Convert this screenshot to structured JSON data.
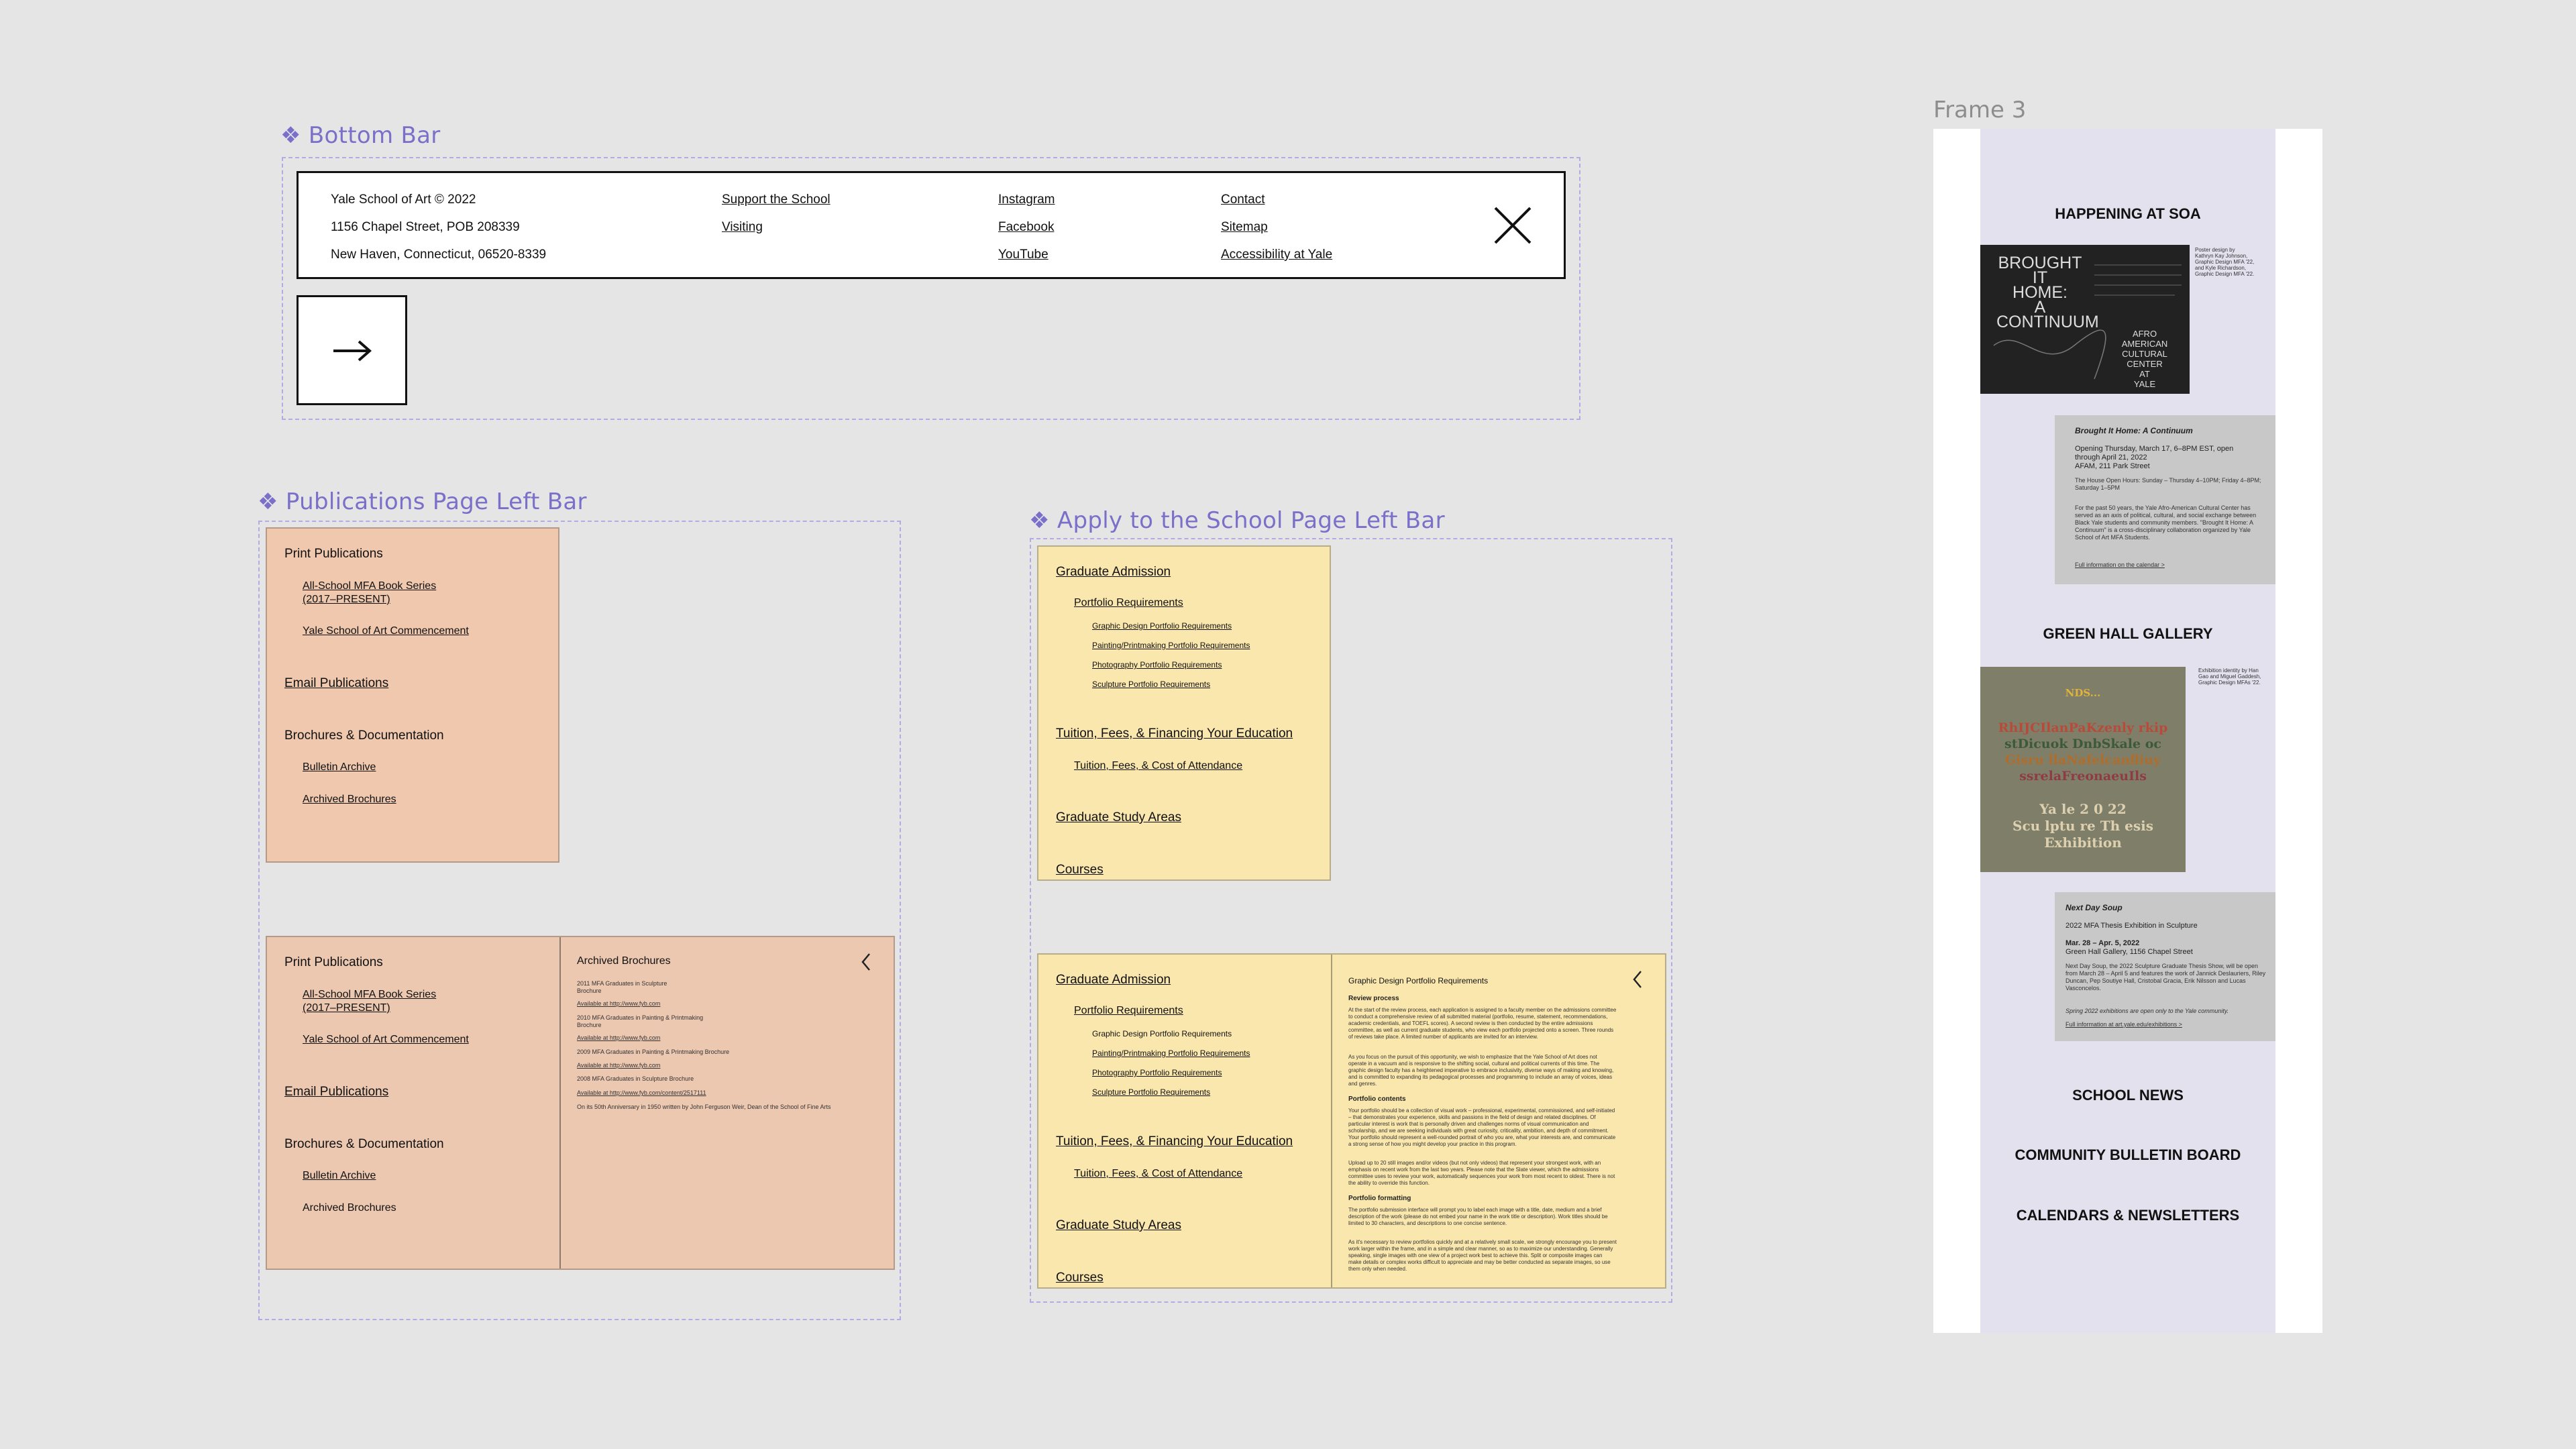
{
  "frame3": {
    "label": "Frame 3",
    "sections": {
      "happening": "HAPPENING AT SOA",
      "gallery": "GREEN HALL GALLERY",
      "news": "SCHOOL NEWS",
      "bulletin": "COMMUNITY BULLETIN BOARD",
      "calendars": "CALENDARS & NEWSLETTERS"
    },
    "poster1": {
      "title_lines": [
        "BROUGHT",
        "IT",
        "HOME:",
        "A",
        "CONTINUUM"
      ],
      "right_lines": [
        "AFRO",
        "AMERICAN",
        "CULTURAL",
        "CENTER",
        "AT",
        "YALE"
      ],
      "credit": [
        "Poster design by",
        "Kathryn Kay Johnson,",
        "Graphic Design MFA '22,",
        "and Kyle Richardson,",
        "Graphic Design MFA '22."
      ]
    },
    "card1": {
      "title": "Brought It Home: A Continuum",
      "lines": [
        "Opening Thursday, March 17, 6–8PM EST, open",
        "through April 21, 2022",
        "AFAM, 211 Park Street"
      ],
      "hours": "The House Open Hours: Sunday – Thursday 4–10PM; Friday 4–8PM; Saturday 1–5PM",
      "body": "For the past 50 years, the Yale Afro-American Cultural Center has served as an axis of political, cultural, and social exchange between Black Yale students and community members. \"Brought It Home: A Continuum\" is a cross-disciplinary collaboration organized by Yale School of Art MFA Students.",
      "link": "Full information on the calendar >"
    },
    "poster2": {
      "lines": [
        "NDS...",
        "RhIJCIlanPaKzenly rkip",
        "stDicuok DnbSkale oc",
        "Gisru llaNafelcanfliuy",
        "ssrelaFreonaeuIls",
        "Ya le 2 0 22",
        "Scu lptu re Th esis",
        "Exhibition"
      ],
      "credit": [
        "Exhibition identity by Han",
        "Gao and Miguel Gaddesh,",
        "Graphic Design MFAs '22."
      ]
    },
    "card2": {
      "title": "Next Day Soup",
      "subtitle": "2022 MFA Thesis Exhibition in Sculpture",
      "date": "Mar. 28 – Apr. 5, 2022",
      "place": "Green Hall Gallery, 1156 Chapel Street",
      "body": "Next Day Soup, the 2022 Sculpture Graduate Thesis Show, will be open from March 28 – April 5 and features the work of Jannick Deslauriers, Riley Duncan, Pep Soutiye Hall, Cristobal Gracia, Erik Nilsson and Lucas Vasconcelos.",
      "note": "Spring 2022 exhibitions are open only to the Yale community.",
      "link": "Full information at art.yale.edu/exhibitions >"
    }
  },
  "bottom_bar": {
    "label": "❖ Bottom Bar",
    "address": [
      "Yale School of Art © 2022",
      "1156 Chapel Street, POB 208339",
      "New Haven, Connecticut, 06520-8339"
    ],
    "col2": [
      "Support the School",
      "Visiting"
    ],
    "col3": [
      "Instagram",
      "Facebook",
      "YouTube"
    ],
    "col4": [
      "Contact",
      "Sitemap",
      "Accessibility at Yale"
    ],
    "close_icon": "×",
    "arrow_icon": "→"
  },
  "publications": {
    "label": "❖ Publications Page Left Bar",
    "menu": {
      "print": "Print Publications",
      "mfa_book": "All-School MFA Book Series",
      "mfa_book_2": "(2017–PRESENT)",
      "commencement": "Yale School of Art Commencement",
      "email": "Email Publications",
      "brochures": "Brochures & Documentation",
      "bulletin": "Bulletin Archive",
      "archived": "Archived Brochures"
    },
    "panel": {
      "title": "Archived Brochures",
      "lines": [
        "2011 MFA Graduates in Sculpture",
        "Brochure",
        "Available at http://www.fyb.com",
        "2010 MFA Graduates in Painting & Printmaking",
        "Brochure",
        "Available at http://www.fyb.com",
        "2009 MFA Graduates in Painting & Printmaking Brochure",
        "Available at http://www.fyb.com",
        "2008 MFA Graduates in Sculpture Brochure",
        "Available at http://www.fyb.com/content/2517111",
        "On its 50th Anniversary in 1950 written by John Ferguson Weir, Dean of the School of Fine Arts"
      ],
      "back_icon": "‹"
    }
  },
  "apply": {
    "label": "❖ Apply to the School Page Left Bar",
    "menu": {
      "admission": "Graduate Admission",
      "portfolio": "Portfolio Requirements",
      "gd": "Graphic Design Portfolio Requirements",
      "pp": "Painting/Printmaking Portfolio Requirements",
      "photo": "Photography Portfolio Requirements",
      "sculpt": "Sculpture Portfolio Requirements",
      "tuition": "Tuition, Fees, & Financing Your Education",
      "tuition_sub": "Tuition, Fees, & Cost of Attendance",
      "study": "Graduate Study Areas",
      "courses": "Courses"
    },
    "panel": {
      "title": "Graphic Design Portfolio Requirements",
      "h_review": "Review process",
      "p_review": "At the start of the review process, each application is assigned to a faculty member on the admissions committee to conduct a comprehensive review of all submitted material (portfolio, resume, statement, recommendations, academic credentials, and TOEFL scores). A second review is then conducted by the entire admissions committee, as well as current graduate students, who view each portfolio projected onto a screen. Three rounds of reviews take place. A limited number of applicants are invited for an interview.",
      "p_review2": "As you focus on the pursuit of this opportunity, we wish to emphasize that the Yale School of Art does not operate in a vacuum and is responsive to the shifting social, cultural and political currents of this time. The graphic design faculty has a heightened imperative to embrace inclusivity, diverse ways of making and knowing, and is committed to expanding its pedagogical processes and programming to include an array of voices, ideas and genres.",
      "h_contents": "Portfolio contents",
      "p_contents": "Your portfolio should be a collection of visual work – professional, experimental, commissioned, and self-initiated – that demonstrates your experience, skills and passions in the field of design and related disciplines. Of particular interest is work that is personally driven and challenges norms of visual communication and scholarship, and we are seeking individuals with great curiosity, criticality, ambition, and depth of commitment. Your portfolio should represent a well-rounded portrait of who you are, what your interests are, and communicate a strong sense of how you might develop your practice in this program.",
      "p_contents2": "Upload up to 20 still images and/or videos (but not only videos) that represent your strongest work, with an emphasis on recent work from the last two years. Please note that the Slate viewer, which the admissions committee uses to review your work, automatically sequences your work from most recent to oldest. There is not the ability to override this function.",
      "h_format": "Portfolio formatting",
      "p_format": "The portfolio submission interface will prompt you to label each image with a title, date, medium and a brief description of the work (please do not embed your name in the work title or description). Work titles should be limited to 30 characters, and descriptions to one concise sentence.",
      "p_format2": "As it's necessary to review portfolios quickly and at a relatively small scale, we strongly encourage you to present work larger within the frame, and in a simple and clear manner, so as to maximize our understanding. Generally speaking, single images with one view of a project work best to achieve this. Split or composite images can make details or complex works difficult to appreciate and may be better conducted as separate images, so use them only when needed.",
      "back_icon": "‹"
    }
  }
}
